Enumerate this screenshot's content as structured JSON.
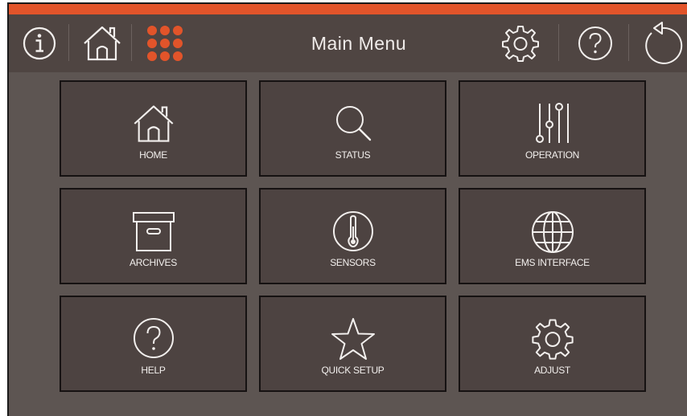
{
  "header": {
    "title": "Main Menu",
    "info_icon": "info-icon",
    "home_icon": "home-icon",
    "menu_icon": "menu-grid-icon",
    "settings_icon": "gear-icon",
    "help_icon": "question-icon",
    "back_icon": "back-arrow-icon"
  },
  "tiles": [
    {
      "label": "HOME",
      "icon": "home-icon"
    },
    {
      "label": "STATUS",
      "icon": "magnifier-icon"
    },
    {
      "label": "OPERATION",
      "icon": "sliders-icon"
    },
    {
      "label": "ARCHIVES",
      "icon": "archive-box-icon"
    },
    {
      "label": "SENSORS",
      "icon": "thermometer-icon"
    },
    {
      "label": "EMS INTERFACE",
      "icon": "globe-icon"
    },
    {
      "label": "HELP",
      "icon": "question-icon"
    },
    {
      "label": "QUICK SETUP",
      "icon": "star-icon"
    },
    {
      "label": "ADJUST",
      "icon": "gear-icon"
    }
  ],
  "colors": {
    "accent": "#e2542a",
    "background": "#5d5552",
    "header": "#4f4542",
    "tile": "#4d4341",
    "tile_border": "#161212",
    "icon_stroke": "#f2efed"
  }
}
